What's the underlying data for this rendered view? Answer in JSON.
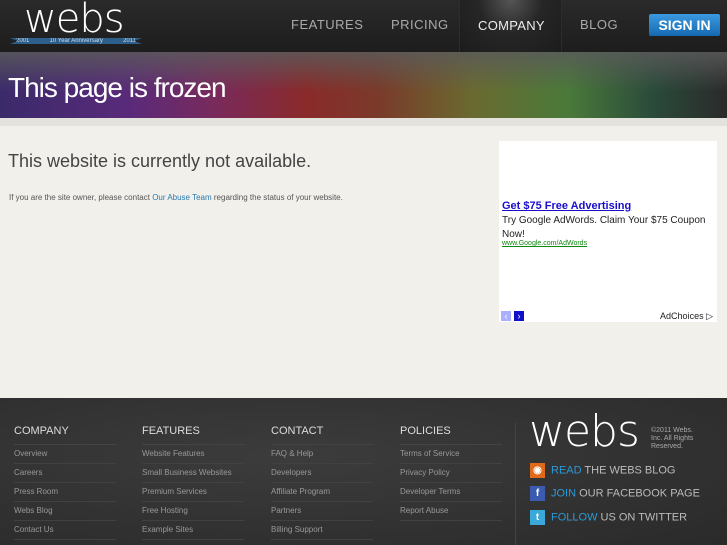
{
  "header": {
    "logo": "webs",
    "anniversary": "10 Year Anniversary",
    "year_start": "2001",
    "year_end": "2011",
    "nav": [
      "FEATURES",
      "PRICING",
      "COMPANY",
      "BLOG"
    ],
    "sign_in": "SIGN IN"
  },
  "banner": {
    "title": "This page is frozen"
  },
  "notice": {
    "title": "This website is currently not available.",
    "text_before": "If you are the site owner, please contact ",
    "link": "Our Abuse Team",
    "text_after": " regarding the status of your website."
  },
  "ad": {
    "title": "Get $75 Free Advertising",
    "description": "Try Google AdWords. Claim Your $75 Coupon Now!",
    "url": "www.Google.com/AdWords",
    "prev": "‹",
    "next": "›",
    "adchoices": "AdChoices ▷"
  },
  "footer": {
    "columns": [
      {
        "heading": "COMPANY",
        "links": [
          "Overview",
          "Careers",
          "Press Room",
          "Webs Blog",
          "Contact Us"
        ]
      },
      {
        "heading": "FEATURES",
        "links": [
          "Website Features",
          "Small Business Websites",
          "Premium Services",
          "Free Hosting",
          "Example Sites"
        ]
      },
      {
        "heading": "CONTACT",
        "links": [
          "FAQ & Help",
          "Developers",
          "Affiliate Program",
          "Partners",
          "Billing Support"
        ]
      },
      {
        "heading": "POLICIES",
        "links": [
          "Terms of Service",
          "Privacy Policy",
          "Developer Terms",
          "Report Abuse"
        ]
      }
    ],
    "logo": "webs",
    "copyright": "©2011 Webs. Inc. All Rights Reserved.",
    "social": [
      {
        "action": "READ",
        "text": " THE WEBS BLOG",
        "icon": "rss-icon",
        "color": "#e06a1a",
        "glyph": "◉"
      },
      {
        "action": "JOIN",
        "text": " OUR FACEBOOK PAGE",
        "icon": "facebook-icon",
        "color": "#3b5bb0",
        "glyph": "f"
      },
      {
        "action": "FOLLOW",
        "text": " US ON TWITTER",
        "icon": "twitter-icon",
        "color": "#3aa8d8",
        "glyph": "t"
      }
    ]
  }
}
